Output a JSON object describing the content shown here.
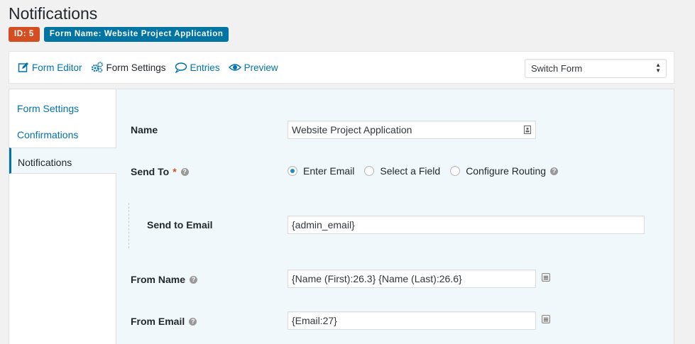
{
  "page": {
    "title": "Notifications"
  },
  "badges": {
    "id": "ID: 5",
    "form_name": "Form Name: Website Project Application"
  },
  "toolbar": {
    "form_editor": "Form Editor",
    "form_settings": "Form Settings",
    "entries": "Entries",
    "preview": "Preview",
    "switch_form": "Switch Form"
  },
  "sidenav": {
    "items": [
      {
        "label": "Form Settings"
      },
      {
        "label": "Confirmations"
      },
      {
        "label": "Notifications"
      }
    ]
  },
  "form": {
    "name_label": "Name",
    "name_value": "Website Project Application",
    "send_to_label": "Send To",
    "send_to_required": "*",
    "send_to_options": [
      "Enter Email",
      "Select a Field",
      "Configure Routing"
    ],
    "send_to_selected": "Enter Email",
    "send_to_email_label": "Send to Email",
    "send_to_email_value": "{admin_email}",
    "from_name_label": "From Name",
    "from_name_value": "{Name (First):26.3} {Name (Last):26.6}",
    "from_email_label": "From Email",
    "from_email_value": "{Email:27}"
  },
  "colors": {
    "accent": "#0074a2",
    "id_badge": "#d54e21",
    "link": "#0073aa"
  }
}
